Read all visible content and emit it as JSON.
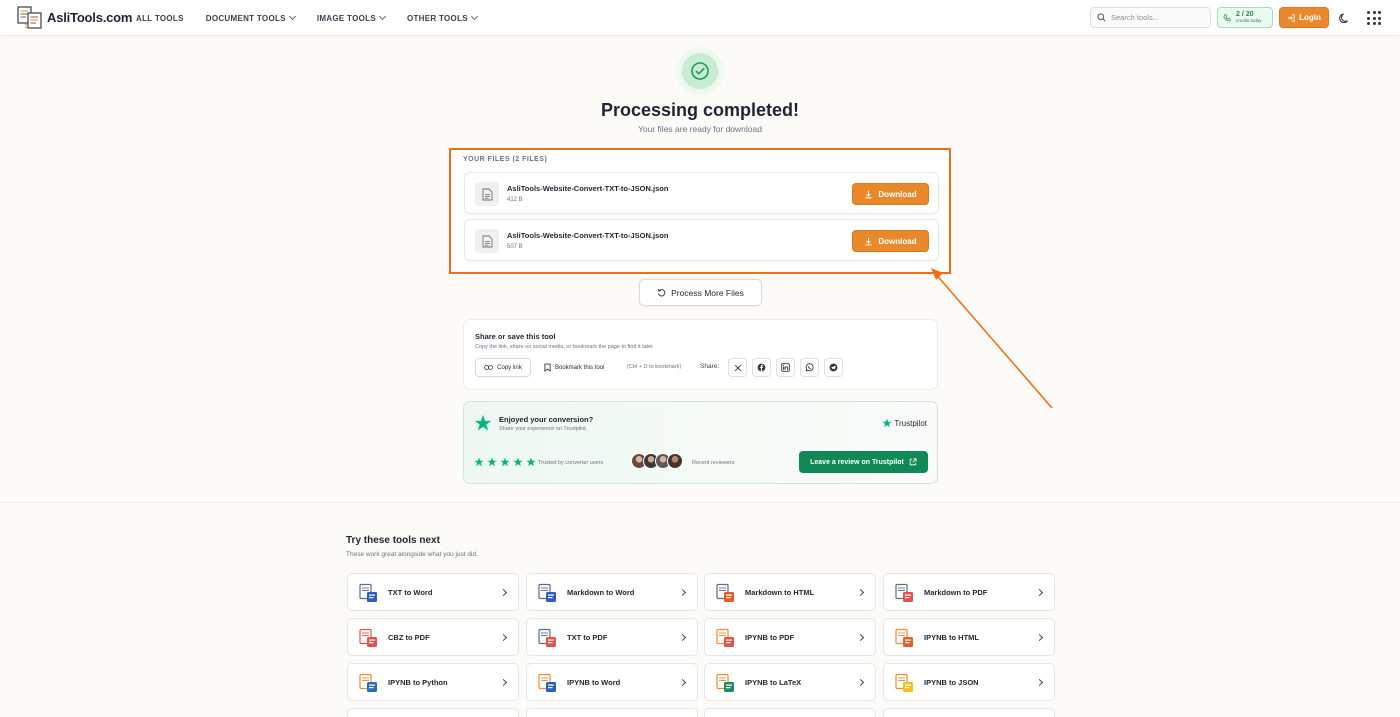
{
  "header": {
    "logo_text": "AsliTools.com",
    "nav": [
      "ALL TOOLS",
      "DOCUMENT TOOLS",
      "IMAGE TOOLS",
      "OTHER TOOLS"
    ],
    "search_placeholder": "Search tools...",
    "credits_value": "2 / 20",
    "credits_sub": "credits today",
    "login_label": "Login"
  },
  "result": {
    "title": "Processing completed!",
    "subtitle": "Your files are ready for download",
    "files_label": "YOUR FILES (2 FILES)",
    "files": [
      {
        "name": "AsliTools-Website-Convert-TXT-to-JSON.json",
        "size": "412 B",
        "action": "Download"
      },
      {
        "name": "AsliTools-Website-Convert-TXT-to-JSON.json",
        "size": "507 B",
        "action": "Download"
      }
    ],
    "process_more_label": "Process More Files"
  },
  "share": {
    "title": "Share or save this tool",
    "desc": "Copy the link, share on social media, or bookmark the page to find it later.",
    "copy_label": "Copy link",
    "bookmark_label": "Bookmark this tool",
    "bookmark_hint": "(Ctrl + D to bookmark)",
    "share_label": "Share:",
    "networks": [
      "x-icon",
      "facebook-icon",
      "linkedin-icon",
      "whatsapp-icon",
      "telegram-icon"
    ]
  },
  "trustpilot": {
    "title": "Enjoyed your conversion?",
    "desc": "Share your experience on Trustpilot.",
    "brand": "Trustpilot",
    "trusted": "Trusted by converter users",
    "recent": "Recent reviewers",
    "cta": "Leave a review on Trustpilot",
    "stars": 5
  },
  "tools": {
    "title": "Try these tools next",
    "sub": "These work great alongside what you just did.",
    "items": [
      {
        "label": "TXT to Word",
        "from": "#5b6b8c",
        "to": "#2b5fb8"
      },
      {
        "label": "Markdown to Word",
        "from": "#5b6b8c",
        "to": "#2b5fb8"
      },
      {
        "label": "Markdown to HTML",
        "from": "#5b6b8c",
        "to": "#e25d2a"
      },
      {
        "label": "Markdown to PDF",
        "from": "#5b6b8c",
        "to": "#e35151"
      },
      {
        "label": "CBZ to PDF",
        "from": "#e35151",
        "to": "#e35151"
      },
      {
        "label": "TXT to PDF",
        "from": "#5b6b8c",
        "to": "#e35151"
      },
      {
        "label": "IPYNB to PDF",
        "from": "#f08a2e",
        "to": "#e35151"
      },
      {
        "label": "IPYNB to HTML",
        "from": "#f08a2e",
        "to": "#e25d2a"
      },
      {
        "label": "IPYNB to Python",
        "from": "#f08a2e",
        "to": "#2b6cb8"
      },
      {
        "label": "IPYNB to Word",
        "from": "#f08a2e",
        "to": "#2b5fb8"
      },
      {
        "label": "IPYNB to LaTeX",
        "from": "#f08a2e",
        "to": "#1f8a6a"
      },
      {
        "label": "IPYNB to JSON",
        "from": "#f08a2e",
        "to": "#e8c41f"
      }
    ]
  },
  "colors": {
    "accent": "#e8892b",
    "success": "#1d9a58",
    "highlight": "#e8701a",
    "trustpilot": "#00b67a"
  }
}
